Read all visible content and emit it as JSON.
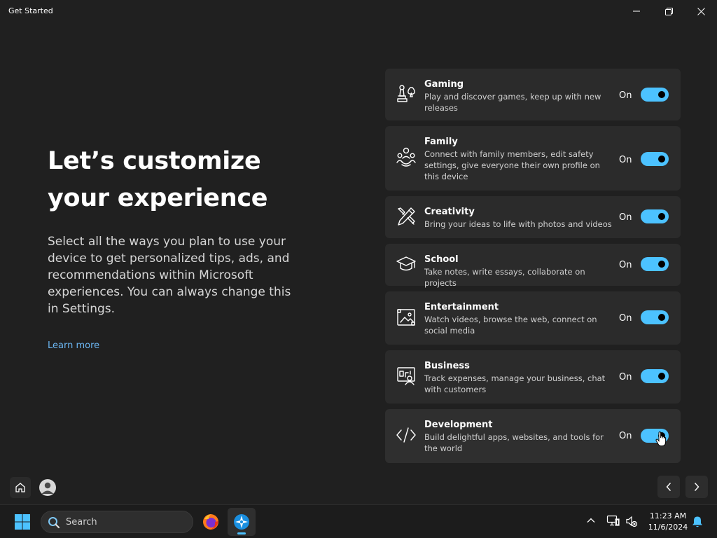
{
  "window": {
    "title": "Get Started"
  },
  "main": {
    "heading_line1": "Let’s customize",
    "heading_line2": "your experience",
    "description": "Select all the ways you plan to use your device to get personalized tips, ads, and recommendations within Microsoft experiences. You can always change this in Settings.",
    "learn_more": "Learn more"
  },
  "options": [
    {
      "title": "Gaming",
      "subtitle": "Play and discover games, keep up with new releases",
      "state": "On",
      "icon": "gaming-icon"
    },
    {
      "title": "Family",
      "subtitle": "Connect with family members, edit safety settings, give everyone their own profile on this device",
      "state": "On",
      "icon": "family-icon"
    },
    {
      "title": "Creativity",
      "subtitle": "Bring your ideas to life with photos and videos",
      "state": "On",
      "icon": "creativity-icon"
    },
    {
      "title": "School",
      "subtitle": "Take notes, write essays, collaborate on projects",
      "state": "On",
      "icon": "school-icon"
    },
    {
      "title": "Entertainment",
      "subtitle": "Watch videos, browse the web, connect on social media",
      "state": "On",
      "icon": "entertainment-icon"
    },
    {
      "title": "Business",
      "subtitle": "Track expenses, manage your business, chat with customers",
      "state": "On",
      "icon": "business-icon"
    },
    {
      "title": "Development",
      "subtitle": "Build delightful apps, websites, and tools for the world",
      "state": "On",
      "icon": "development-icon"
    }
  ],
  "taskbar": {
    "search_placeholder": "Search",
    "time": "11:23 AM",
    "date": "11/6/2024"
  },
  "colors": {
    "accent": "#4cc2ff",
    "background": "#202020",
    "card": "#2b2b2b",
    "link": "#6cb8f5"
  }
}
